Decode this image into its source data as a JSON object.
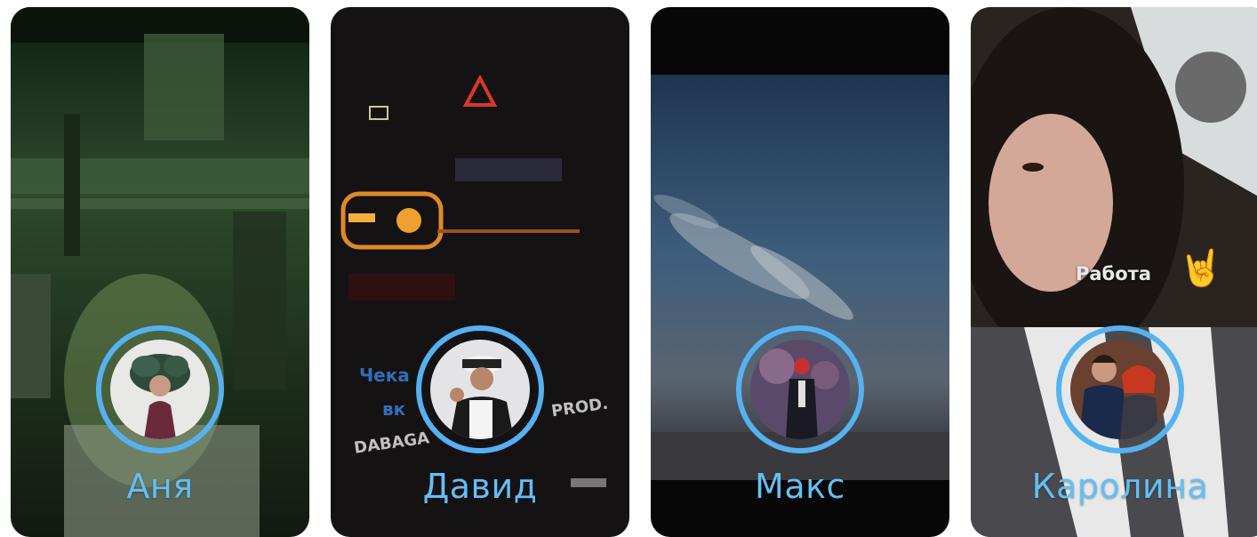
{
  "colors": {
    "ring": "#55b2f2",
    "name": "#63bff4",
    "background": "#ffffff"
  },
  "stories": [
    {
      "name": "Аня"
    },
    {
      "name": "Давид",
      "overlay": {
        "line1": "Чека",
        "line2": "вк",
        "line3": "DABAGA",
        "line4": "PROD."
      }
    },
    {
      "name": "Макс"
    },
    {
      "name": "Каролина",
      "sticker": {
        "text": "Работа",
        "emoji": "🤘"
      }
    }
  ]
}
